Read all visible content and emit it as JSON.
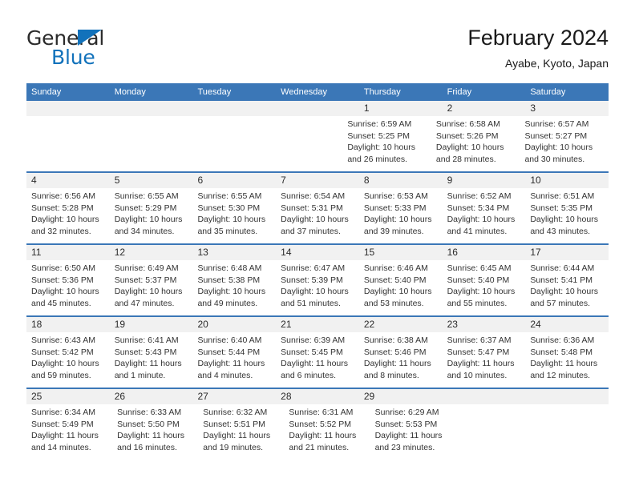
{
  "brand": {
    "name_top": "General",
    "name_bottom": "Blue",
    "flag_icon": "triangle-flag-icon",
    "colors": {
      "blue": "#1272bb",
      "dark": "#2b2b2b"
    }
  },
  "header": {
    "title": "February 2024",
    "subtitle": "Ayabe, Kyoto, Japan"
  },
  "theme": {
    "header_blue": "#3b77b7",
    "date_band_gray": "#f1f1f1",
    "text": "#333333"
  },
  "calendar": {
    "weekday_labels": [
      "Sunday",
      "Monday",
      "Tuesday",
      "Wednesday",
      "Thursday",
      "Friday",
      "Saturday"
    ],
    "weeks": [
      {
        "days": [
          {
            "date": "",
            "lines": []
          },
          {
            "date": "",
            "lines": []
          },
          {
            "date": "",
            "lines": []
          },
          {
            "date": "",
            "lines": []
          },
          {
            "date": "1",
            "lines": [
              "Sunrise: 6:59 AM",
              "Sunset: 5:25 PM",
              "Daylight: 10 hours",
              "and 26 minutes."
            ]
          },
          {
            "date": "2",
            "lines": [
              "Sunrise: 6:58 AM",
              "Sunset: 5:26 PM",
              "Daylight: 10 hours",
              "and 28 minutes."
            ]
          },
          {
            "date": "3",
            "lines": [
              "Sunrise: 6:57 AM",
              "Sunset: 5:27 PM",
              "Daylight: 10 hours",
              "and 30 minutes."
            ]
          }
        ]
      },
      {
        "days": [
          {
            "date": "4",
            "lines": [
              "Sunrise: 6:56 AM",
              "Sunset: 5:28 PM",
              "Daylight: 10 hours",
              "and 32 minutes."
            ]
          },
          {
            "date": "5",
            "lines": [
              "Sunrise: 6:55 AM",
              "Sunset: 5:29 PM",
              "Daylight: 10 hours",
              "and 34 minutes."
            ]
          },
          {
            "date": "6",
            "lines": [
              "Sunrise: 6:55 AM",
              "Sunset: 5:30 PM",
              "Daylight: 10 hours",
              "and 35 minutes."
            ]
          },
          {
            "date": "7",
            "lines": [
              "Sunrise: 6:54 AM",
              "Sunset: 5:31 PM",
              "Daylight: 10 hours",
              "and 37 minutes."
            ]
          },
          {
            "date": "8",
            "lines": [
              "Sunrise: 6:53 AM",
              "Sunset: 5:33 PM",
              "Daylight: 10 hours",
              "and 39 minutes."
            ]
          },
          {
            "date": "9",
            "lines": [
              "Sunrise: 6:52 AM",
              "Sunset: 5:34 PM",
              "Daylight: 10 hours",
              "and 41 minutes."
            ]
          },
          {
            "date": "10",
            "lines": [
              "Sunrise: 6:51 AM",
              "Sunset: 5:35 PM",
              "Daylight: 10 hours",
              "and 43 minutes."
            ]
          }
        ]
      },
      {
        "days": [
          {
            "date": "11",
            "lines": [
              "Sunrise: 6:50 AM",
              "Sunset: 5:36 PM",
              "Daylight: 10 hours",
              "and 45 minutes."
            ]
          },
          {
            "date": "12",
            "lines": [
              "Sunrise: 6:49 AM",
              "Sunset: 5:37 PM",
              "Daylight: 10 hours",
              "and 47 minutes."
            ]
          },
          {
            "date": "13",
            "lines": [
              "Sunrise: 6:48 AM",
              "Sunset: 5:38 PM",
              "Daylight: 10 hours",
              "and 49 minutes."
            ]
          },
          {
            "date": "14",
            "lines": [
              "Sunrise: 6:47 AM",
              "Sunset: 5:39 PM",
              "Daylight: 10 hours",
              "and 51 minutes."
            ]
          },
          {
            "date": "15",
            "lines": [
              "Sunrise: 6:46 AM",
              "Sunset: 5:40 PM",
              "Daylight: 10 hours",
              "and 53 minutes."
            ]
          },
          {
            "date": "16",
            "lines": [
              "Sunrise: 6:45 AM",
              "Sunset: 5:40 PM",
              "Daylight: 10 hours",
              "and 55 minutes."
            ]
          },
          {
            "date": "17",
            "lines": [
              "Sunrise: 6:44 AM",
              "Sunset: 5:41 PM",
              "Daylight: 10 hours",
              "and 57 minutes."
            ]
          }
        ]
      },
      {
        "days": [
          {
            "date": "18",
            "lines": [
              "Sunrise: 6:43 AM",
              "Sunset: 5:42 PM",
              "Daylight: 10 hours",
              "and 59 minutes."
            ]
          },
          {
            "date": "19",
            "lines": [
              "Sunrise: 6:41 AM",
              "Sunset: 5:43 PM",
              "Daylight: 11 hours",
              "and 1 minute."
            ]
          },
          {
            "date": "20",
            "lines": [
              "Sunrise: 6:40 AM",
              "Sunset: 5:44 PM",
              "Daylight: 11 hours",
              "and 4 minutes."
            ]
          },
          {
            "date": "21",
            "lines": [
              "Sunrise: 6:39 AM",
              "Sunset: 5:45 PM",
              "Daylight: 11 hours",
              "and 6 minutes."
            ]
          },
          {
            "date": "22",
            "lines": [
              "Sunrise: 6:38 AM",
              "Sunset: 5:46 PM",
              "Daylight: 11 hours",
              "and 8 minutes."
            ]
          },
          {
            "date": "23",
            "lines": [
              "Sunrise: 6:37 AM",
              "Sunset: 5:47 PM",
              "Daylight: 11 hours",
              "and 10 minutes."
            ]
          },
          {
            "date": "24",
            "lines": [
              "Sunrise: 6:36 AM",
              "Sunset: 5:48 PM",
              "Daylight: 11 hours",
              "and 12 minutes."
            ]
          }
        ]
      },
      {
        "days": [
          {
            "date": "25",
            "lines": [
              "Sunrise: 6:34 AM",
              "Sunset: 5:49 PM",
              "Daylight: 11 hours",
              "and 14 minutes."
            ]
          },
          {
            "date": "26",
            "lines": [
              "Sunrise: 6:33 AM",
              "Sunset: 5:50 PM",
              "Daylight: 11 hours",
              "and 16 minutes."
            ]
          },
          {
            "date": "27",
            "lines": [
              "Sunrise: 6:32 AM",
              "Sunset: 5:51 PM",
              "Daylight: 11 hours",
              "and 19 minutes."
            ]
          },
          {
            "date": "28",
            "lines": [
              "Sunrise: 6:31 AM",
              "Sunset: 5:52 PM",
              "Daylight: 11 hours",
              "and 21 minutes."
            ]
          },
          {
            "date": "29",
            "lines": [
              "Sunrise: 6:29 AM",
              "Sunset: 5:53 PM",
              "Daylight: 11 hours",
              "and 23 minutes."
            ]
          },
          {
            "date": "",
            "lines": []
          },
          {
            "date": "",
            "lines": []
          }
        ]
      }
    ]
  }
}
